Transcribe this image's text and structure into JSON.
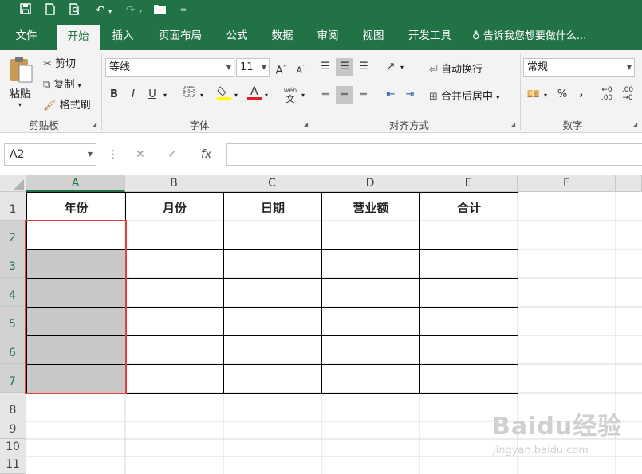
{
  "quick_access": {
    "save_icon": "save-icon",
    "new_icon": "new-file-icon",
    "preview_icon": "print-preview-icon",
    "undo_icon": "undo-icon",
    "redo_icon": "redo-icon",
    "open_icon": "open-folder-icon",
    "customize_icon": "customize-qat-icon"
  },
  "tabs": [
    "文件",
    "开始",
    "插入",
    "页面布局",
    "公式",
    "数据",
    "审阅",
    "视图",
    "开发工具"
  ],
  "tell_me": "告诉我您想要做什么...",
  "clipboard": {
    "paste": "粘贴",
    "cut": "剪切",
    "copy": "复制",
    "format_painter": "格式刷",
    "label": "剪贴板"
  },
  "font": {
    "name": "等线",
    "size": "11",
    "bold": "B",
    "italic": "I",
    "underline": "U",
    "label": "字体",
    "wen": "wén",
    "wen_char": "文"
  },
  "alignment": {
    "wrap_text": "自动换行",
    "merge_center": "合并后居中",
    "label": "对齐方式"
  },
  "number": {
    "format": "常规",
    "percent": "%",
    "comma": ",",
    "label": "数字"
  },
  "formula_bar": {
    "name_box": "A2",
    "fx": "fx",
    "value": ""
  },
  "grid": {
    "columns": [
      "A",
      "B",
      "C",
      "D",
      "E",
      "F"
    ],
    "rows": [
      "1",
      "2",
      "3",
      "4",
      "5",
      "6",
      "7",
      "8",
      "9",
      "10",
      "11"
    ],
    "headers": [
      "年份",
      "月份",
      "日期",
      "营业额",
      "合计"
    ]
  },
  "colors": {
    "accent": "#217346",
    "selection_outline": "#e04040",
    "shade": "#c8c8c8"
  },
  "watermark": {
    "brand": "Baidu经验",
    "url": "jingyan.baidu.com"
  }
}
